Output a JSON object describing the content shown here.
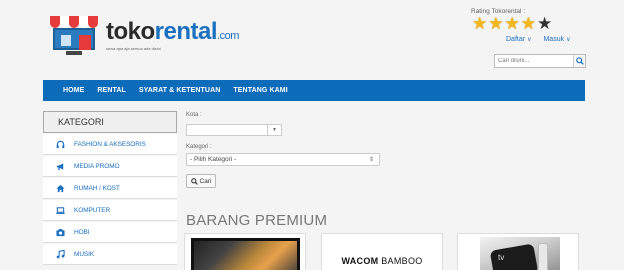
{
  "header": {
    "brand_prefix": "toko",
    "brand_highlight": "rental",
    "brand_suffix": ".com",
    "tagline": "sewa apa aja semua ada disini",
    "rating_label": "Rating Tokorental :",
    "rating": {
      "filled": 4,
      "total": 5
    },
    "daftar_label": "Daftar",
    "masuk_label": "Masuk",
    "search_placeholder": "Cari disini..."
  },
  "nav": {
    "items": [
      "HOME",
      "RENTAL",
      "SYARAT & KETENTUAN",
      "TENTANG KAMI"
    ]
  },
  "sidebar": {
    "title": "KATEGORI",
    "items": [
      {
        "label": "FASHION & AKSESORIS",
        "icon": "headphones-icon"
      },
      {
        "label": "MEDIA PROMO",
        "icon": "megaphone-icon"
      },
      {
        "label": "RUMAH / KOST",
        "icon": "home-icon"
      },
      {
        "label": "KOMPUTER",
        "icon": "laptop-icon"
      },
      {
        "label": "HOBI",
        "icon": "camera-icon"
      },
      {
        "label": "MUSIK",
        "icon": "music-icon"
      }
    ]
  },
  "filter": {
    "kota_label": "Kota :",
    "kota_value": "",
    "kategori_label": "Kategori :",
    "kategori_value": "- Pilih Kategori -",
    "cari_label": "Cari"
  },
  "premium": {
    "title": "BARANG PREMIUM",
    "products": [
      {
        "kind": "tablet-image"
      },
      {
        "kind": "logo-text",
        "text_bold": "WACOM",
        "text_light": "BAMBOO"
      },
      {
        "kind": "apple-tv-image",
        "label": "tv"
      }
    ]
  },
  "colors": {
    "brand_blue": "#0c6cb9",
    "star_gold": "#f3b81b",
    "link_blue": "#1b6fc0"
  }
}
